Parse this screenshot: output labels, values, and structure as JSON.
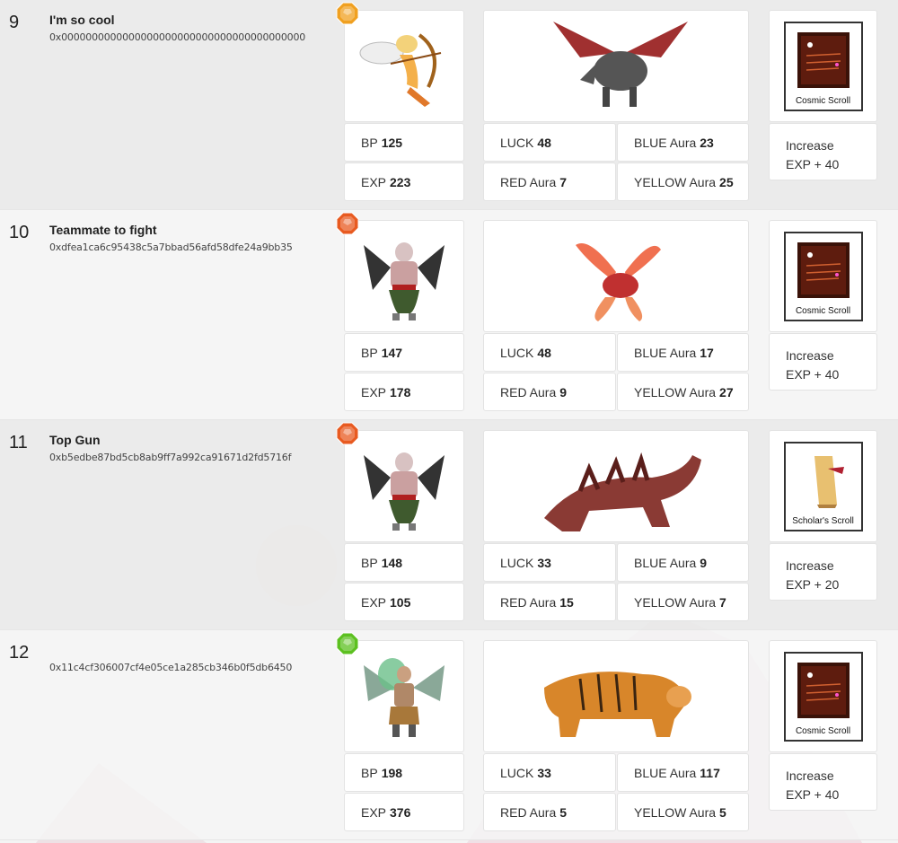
{
  "rows": [
    {
      "rank": "9",
      "name": "I'm so cool",
      "address": "0x0000000000000000000000000000000000000000",
      "gem_color": "#f0a020",
      "bp_label": "BP",
      "bp": "125",
      "exp_label": "EXP",
      "exp": "223",
      "luck_label": "LUCK",
      "luck": "48",
      "blue_label": "BLUE Aura",
      "blue": "23",
      "red_label": "RED Aura",
      "red": "7",
      "yellow_label": "YELLOW Aura",
      "yellow": "25",
      "scroll_name": "Cosmic Scroll",
      "scroll_effect": "Increase EXP + 40",
      "hero_icon": "winged-archer-icon",
      "pet_icon": "dragon-icon"
    },
    {
      "rank": "10",
      "name": "Teammate to fight",
      "address": "0xdfea1ca6c95438c5a7bbad56afd58dfe24a9bb35",
      "gem_color": "#e85a20",
      "bp_label": "BP",
      "bp": "147",
      "exp_label": "EXP",
      "exp": "178",
      "luck_label": "LUCK",
      "luck": "48",
      "blue_label": "BLUE Aura",
      "blue": "17",
      "red_label": "RED Aura",
      "red": "9",
      "yellow_label": "YELLOW Aura",
      "yellow": "27",
      "scroll_name": "Cosmic Scroll",
      "scroll_effect": "Increase EXP + 40",
      "hero_icon": "demon-warrior-icon",
      "pet_icon": "phoenix-icon"
    },
    {
      "rank": "11",
      "name": "Top Gun",
      "address": "0xb5edbe87bd5cb8ab9ff7a992ca91671d2fd5716f",
      "gem_color": "#e85a20",
      "bp_label": "BP",
      "bp": "148",
      "exp_label": "EXP",
      "exp": "105",
      "luck_label": "LUCK",
      "luck": "33",
      "blue_label": "BLUE Aura",
      "blue": "9",
      "red_label": "RED Aura",
      "red": "15",
      "yellow_label": "YELLOW Aura",
      "yellow": "7",
      "scroll_name": "Scholar's Scroll",
      "scroll_effect": "Increase EXP + 20",
      "hero_icon": "demon-warrior-icon",
      "pet_icon": "spiked-beast-icon"
    },
    {
      "rank": "12",
      "name": "",
      "address": "0x11c4cf306007cf4e05ce1a285cb346b0f5db6450",
      "gem_color": "#5cc020",
      "bp_label": "BP",
      "bp": "198",
      "exp_label": "EXP",
      "exp": "376",
      "luck_label": "LUCK",
      "luck": "33",
      "blue_label": "BLUE Aura",
      "blue": "117",
      "red_label": "RED Aura",
      "red": "5",
      "yellow_label": "YELLOW Aura",
      "yellow": "5",
      "scroll_name": "Cosmic Scroll",
      "scroll_effect": "Increase EXP + 40",
      "hero_icon": "shaman-icon",
      "pet_icon": "tiger-icon"
    }
  ]
}
